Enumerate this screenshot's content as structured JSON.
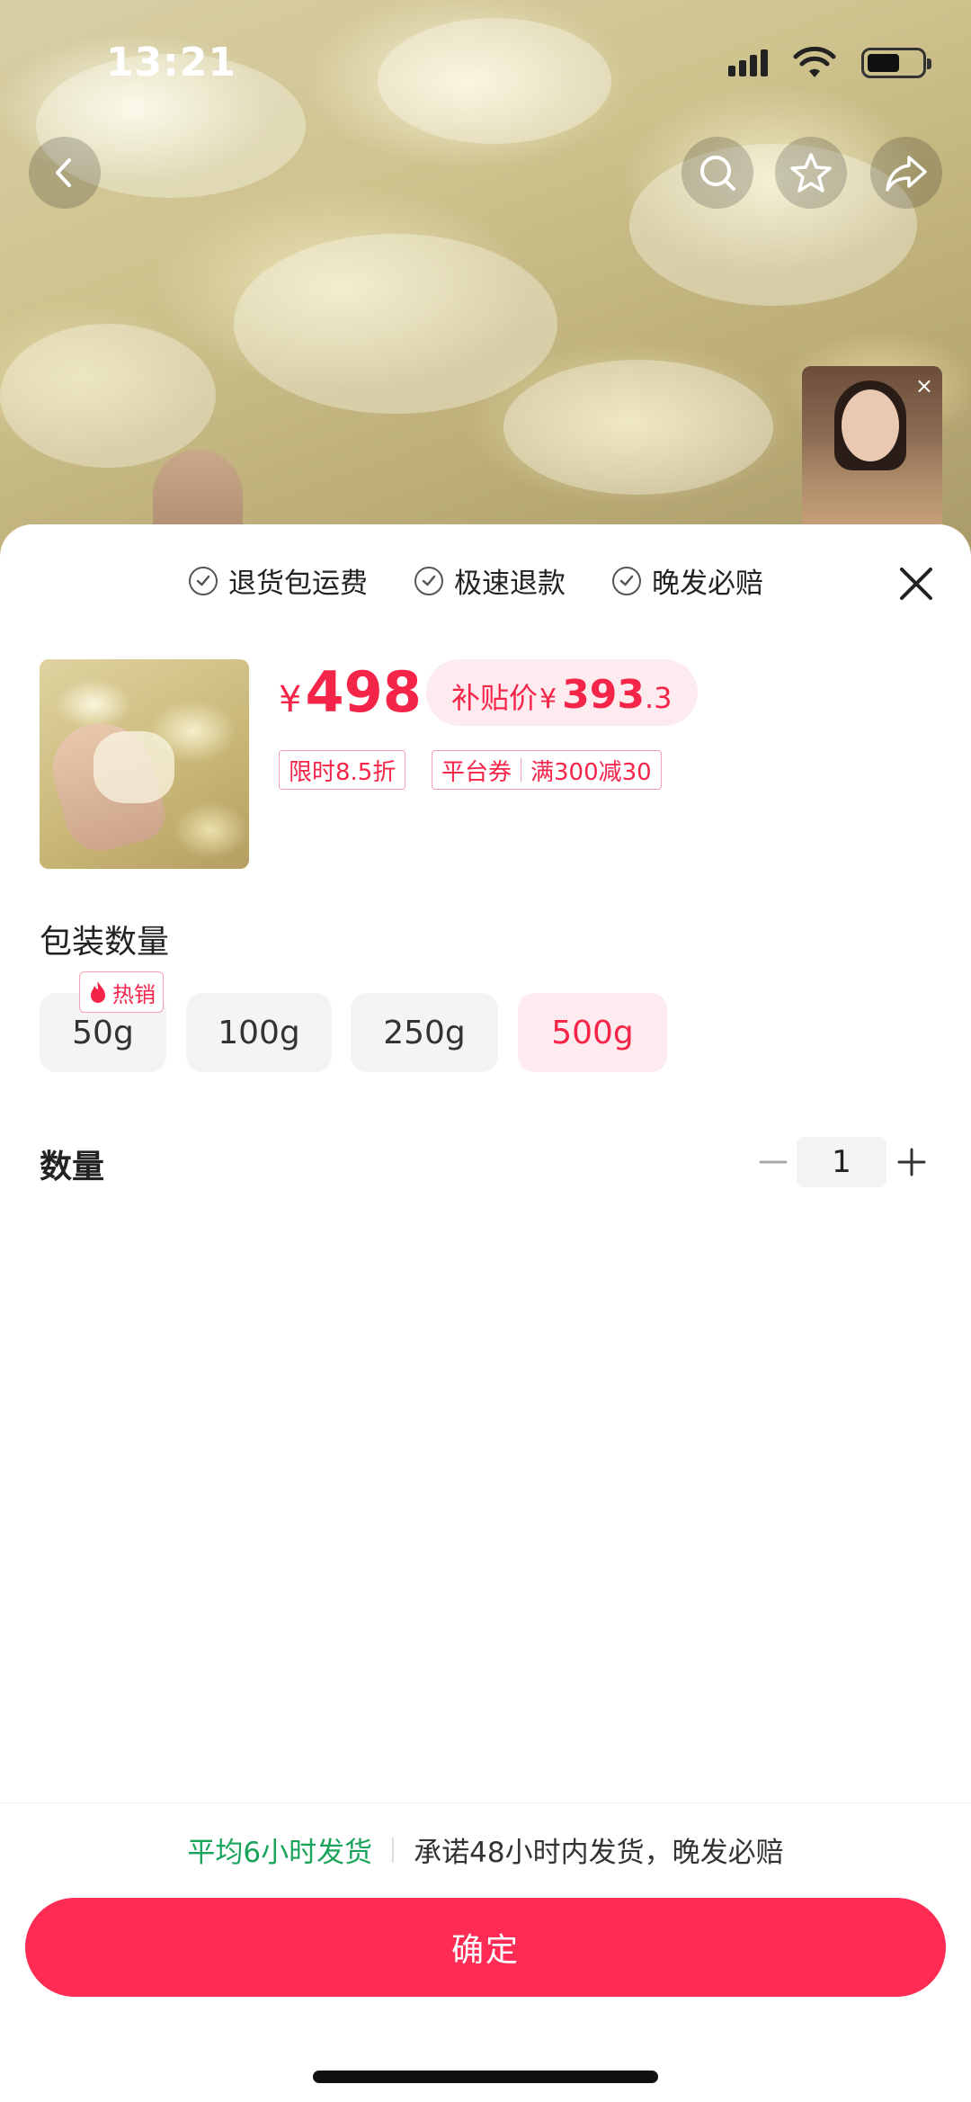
{
  "status_bar": {
    "time": "13:21"
  },
  "live_thumb": {
    "close_glyph": "×"
  },
  "guarantees": [
    {
      "label": "退货包运费"
    },
    {
      "label": "极速退款"
    },
    {
      "label": "晚发必赔"
    }
  ],
  "price": {
    "currency": "¥",
    "value": "498",
    "subsidy_label": "补贴价",
    "subsidy_currency": "¥",
    "subsidy_int": "393",
    "subsidy_dec": ".3"
  },
  "tags": {
    "discount": "限时8.5折",
    "coupon_label": "平台券",
    "coupon_value": "满300减30"
  },
  "package": {
    "title": "包装数量",
    "hot_badge": "热销",
    "options": [
      "50g",
      "100g",
      "250g",
      "500g"
    ],
    "selected": "500g"
  },
  "quantity": {
    "label": "数量",
    "value": "1"
  },
  "shipping": {
    "average": "平均6小时发货",
    "promise": "承诺48小时内发货，晚发必赔"
  },
  "confirm_label": "确定",
  "colors": {
    "accent": "#fe2c55",
    "price": "#f5254a",
    "green": "#1aa45b"
  }
}
